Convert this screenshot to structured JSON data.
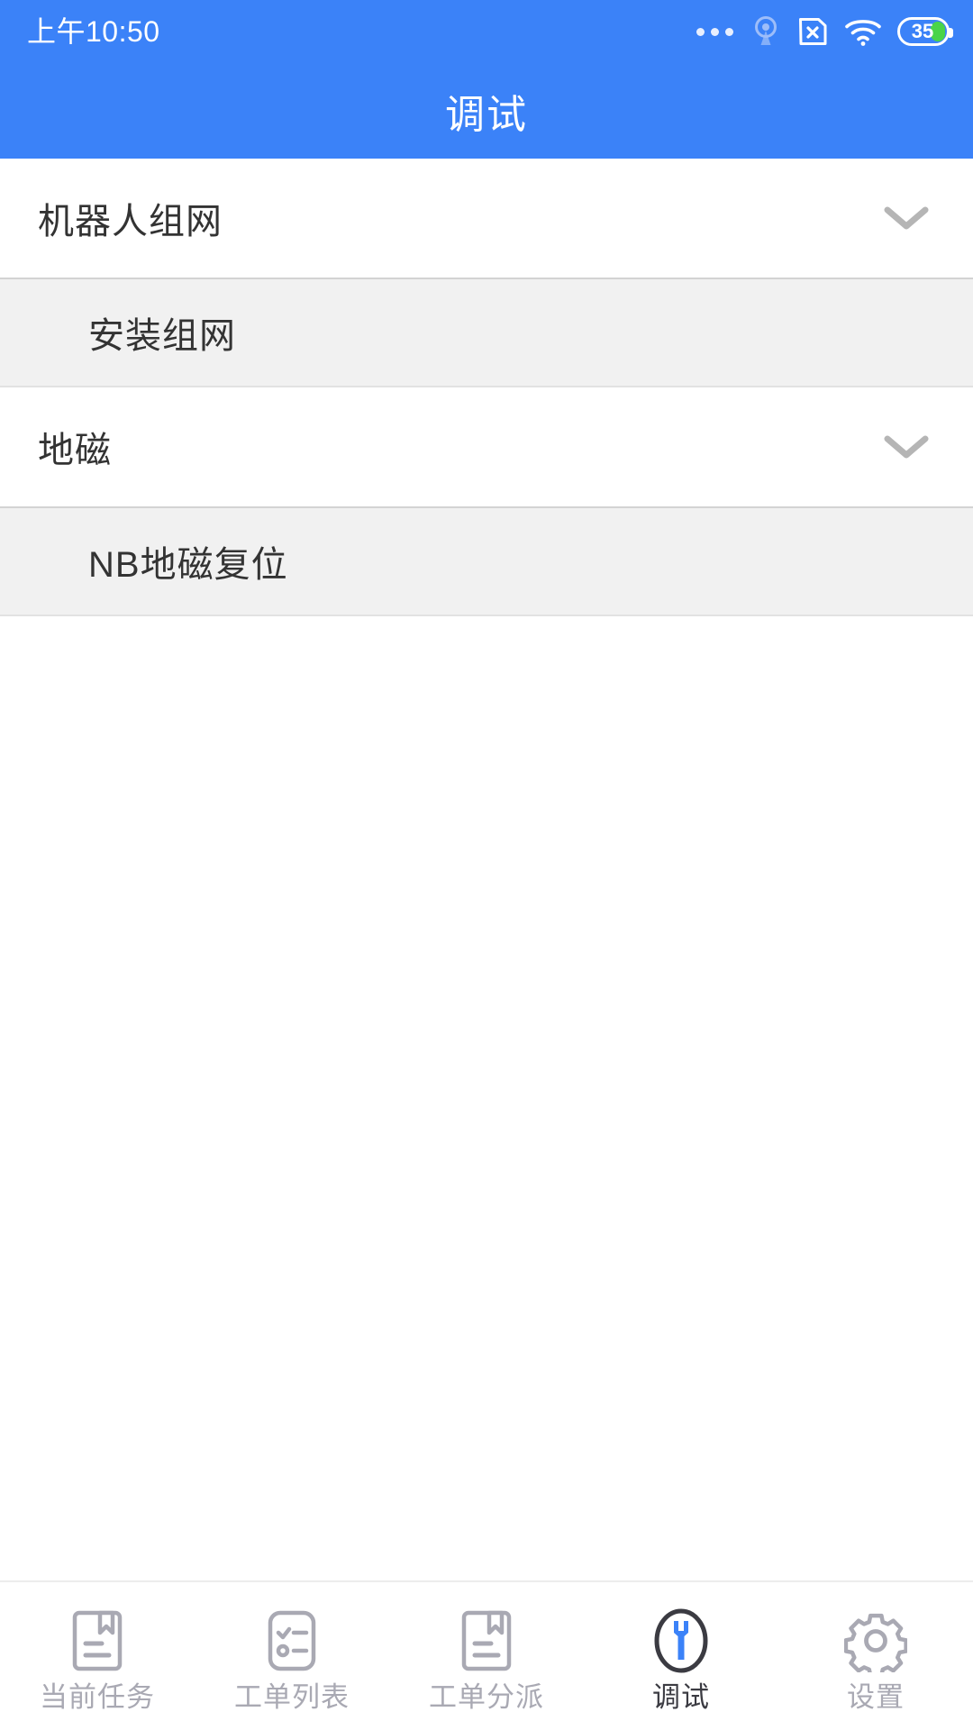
{
  "status_bar": {
    "time": "上午10:50",
    "icons": [
      {
        "name": "more-dots-icon"
      },
      {
        "name": "hotspot-icon"
      },
      {
        "name": "sim-card-disabled-icon"
      },
      {
        "name": "wifi-icon"
      },
      {
        "name": "battery-icon"
      }
    ],
    "battery_level": "35",
    "battery_fill_color": "#4ad449",
    "background_color": "#3b82f8",
    "text_color": "#ffffff"
  },
  "app_bar": {
    "title": "调试",
    "background_color": "#3b82f8",
    "title_color": "#ffffff"
  },
  "list": {
    "groups": [
      {
        "header": "机器人组网",
        "expand_icon": "chevron-down-icon",
        "items": [
          {
            "label": "安装组网"
          }
        ]
      },
      {
        "header": "地磁",
        "expand_icon": "chevron-down-icon",
        "items": [
          {
            "label": "NB地磁复位"
          }
        ]
      }
    ],
    "header_background": "#ffffff",
    "item_background": "#f1f1f1",
    "text_color": "#333333"
  },
  "bottom_nav": {
    "active_index": 3,
    "inactive_color": "#a9a9b3",
    "active_color": "#3b3b42",
    "active_accent_color": "#3b82f8",
    "items": [
      {
        "label": "当前任务",
        "icon": "document-bookmark-icon"
      },
      {
        "label": "工单列表",
        "icon": "checklist-icon"
      },
      {
        "label": "工单分派",
        "icon": "document-bookmark-icon"
      },
      {
        "label": "调试",
        "icon": "wrench-circle-icon"
      },
      {
        "label": "设置",
        "icon": "gear-icon"
      }
    ]
  }
}
